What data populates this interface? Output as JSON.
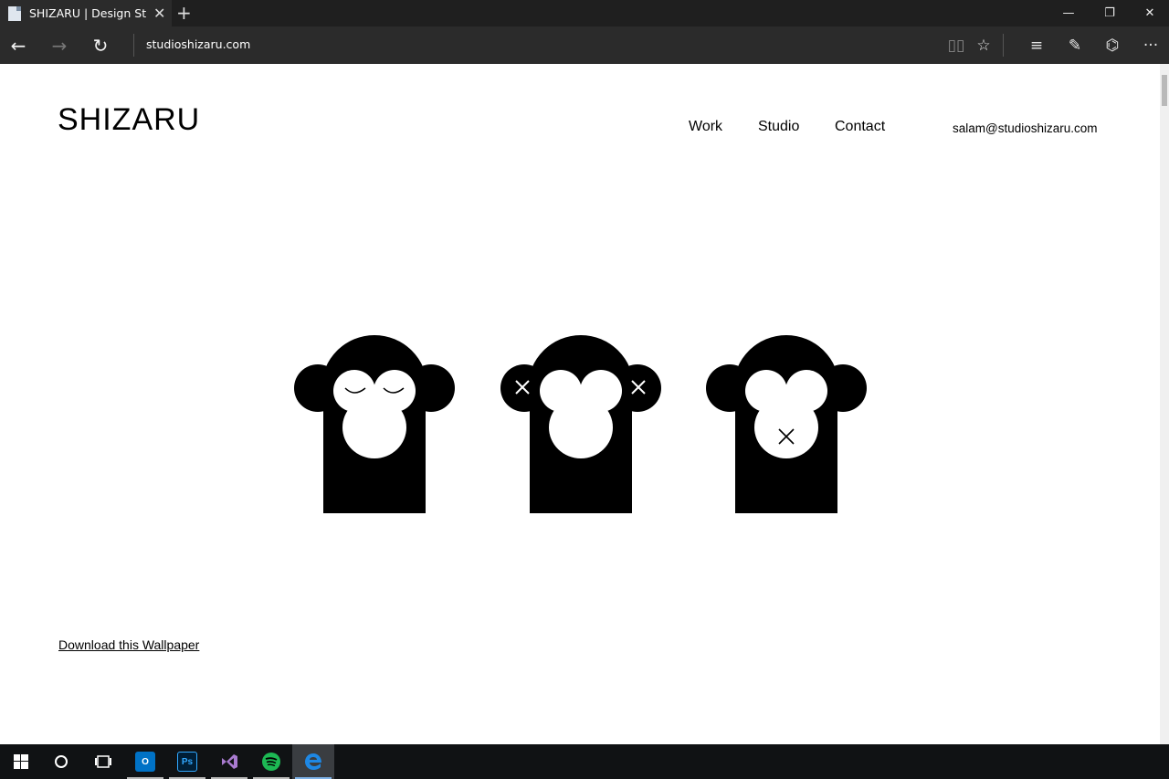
{
  "browser": {
    "tab_title": "SHIZARU | Design Studi",
    "url": "studioshizaru.com"
  },
  "site": {
    "logo": "SHIZARU",
    "nav": [
      "Work",
      "Studio",
      "Contact"
    ],
    "email": "salam@studioshizaru.com",
    "download_link": "Download this Wallpaper"
  },
  "taskbar": {
    "apps": [
      "windows-start",
      "cortana",
      "task-view",
      "outlook",
      "photoshop",
      "visual-studio",
      "spotify",
      "edge"
    ],
    "photoshop_label": "Ps",
    "outlook_label": "O"
  },
  "colors": {
    "page_bg": "#ffffff",
    "chrome_bg": "#2b2b2b",
    "taskbar_bg": "#101214",
    "spotify": "#1db954",
    "edge": "#1e88e5",
    "vs": "#68217a",
    "ps": "#001e36"
  }
}
